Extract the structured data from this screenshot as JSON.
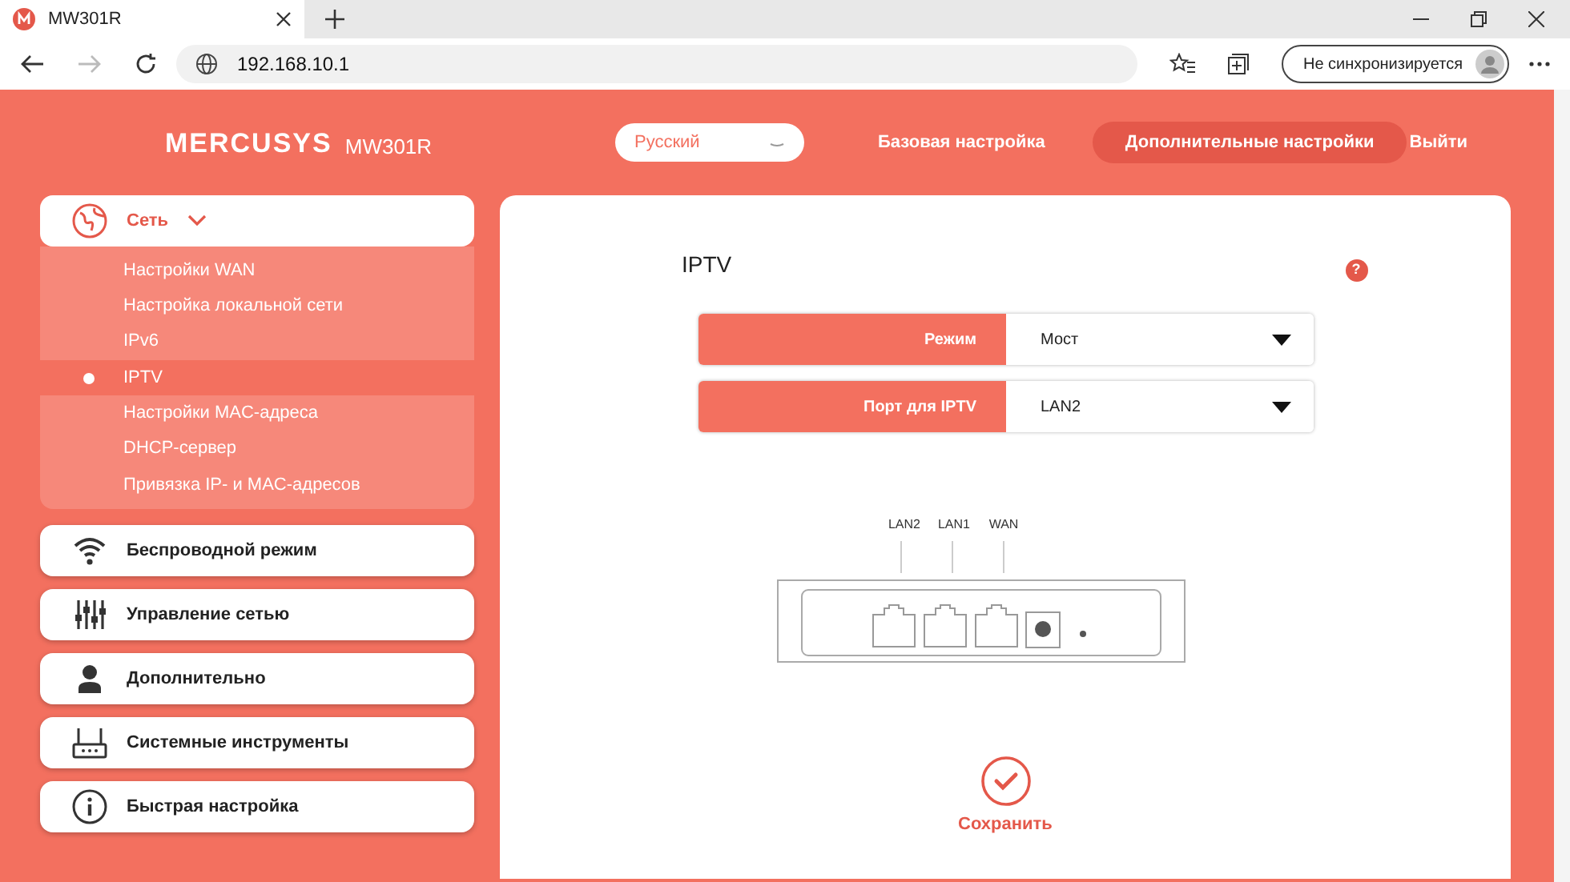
{
  "browser": {
    "tab_title": "MW301R",
    "address": "192.168.10.1",
    "sync_label": "Не синхронизируется"
  },
  "header": {
    "logo": "MERCUSYS",
    "model": "MW301R",
    "language": "Русский",
    "nav": [
      {
        "label": "Базовая настройка",
        "selected": false
      },
      {
        "label": "Дополнительные настройки",
        "selected": true
      }
    ],
    "logout": "Выйти"
  },
  "sidebar": [
    {
      "kind": "globe",
      "label": "Сеть",
      "expanded": true,
      "children": [
        {
          "label": "Настройки WAN",
          "selected": false
        },
        {
          "label": "Настройка локальной сети",
          "selected": false
        },
        {
          "label": "IPv6",
          "selected": false
        },
        {
          "label": "IPTV",
          "selected": true
        },
        {
          "label": "Настройки MAC-адреса",
          "selected": false
        },
        {
          "label": "DHCP-сервер",
          "selected": false
        },
        {
          "label": "Привязка IP- и MAC-адресов",
          "selected": false
        }
      ]
    },
    {
      "kind": "wifi",
      "label": "Беспроводной режим"
    },
    {
      "kind": "sliders",
      "label": "Управление сетью"
    },
    {
      "kind": "person",
      "label": "Дополнительно"
    },
    {
      "kind": "router",
      "label": "Системные инструменты"
    },
    {
      "kind": "info",
      "label": "Быстрая настройка"
    }
  ],
  "content": {
    "title": "IPTV",
    "help": "?",
    "fields": [
      {
        "label": "Режим",
        "value": "Мост"
      },
      {
        "label": "Порт для IPTV",
        "value": "LAN2"
      }
    ],
    "ports": [
      "LAN2",
      "LAN1",
      "WAN"
    ],
    "save": "Сохранить"
  }
}
